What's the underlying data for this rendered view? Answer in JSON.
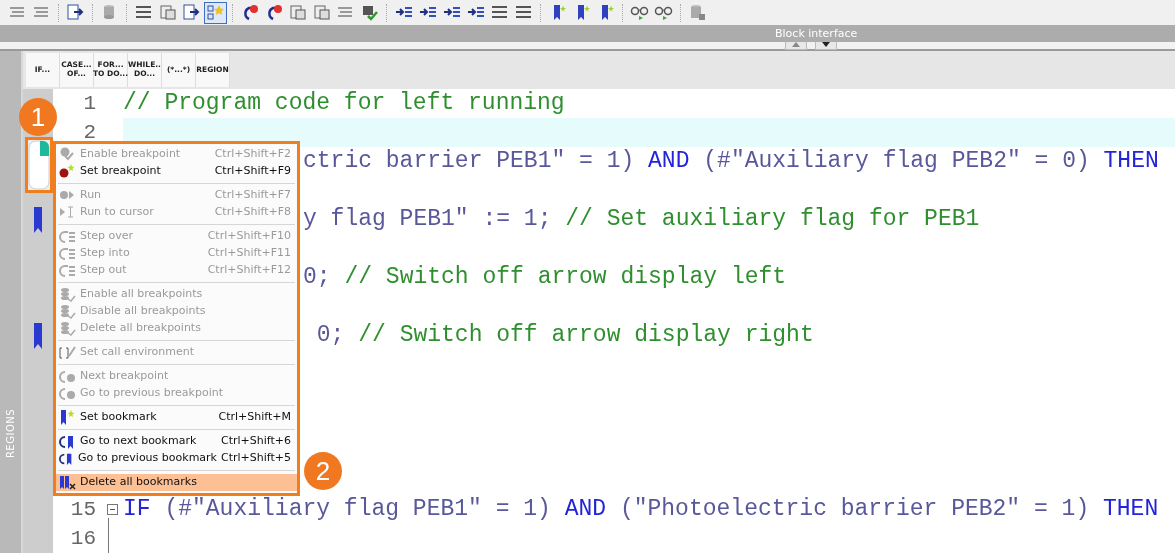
{
  "toolbar": {
    "buttons": [
      {
        "selected": false
      },
      {
        "selected": false
      },
      {
        "selected": false
      },
      {
        "selected": false
      },
      {
        "selected": false
      },
      {
        "selected": false
      },
      {
        "selected": false
      },
      {
        "selected": true
      },
      {
        "selected": false
      },
      {
        "selected": false
      },
      {
        "selected": false
      },
      {
        "selected": false
      },
      {
        "selected": false
      },
      {
        "selected": false
      },
      {
        "selected": false
      },
      {
        "selected": false
      },
      {
        "selected": false
      },
      {
        "selected": false
      },
      {
        "selected": false
      },
      {
        "selected": false
      },
      {
        "selected": false
      },
      {
        "selected": false
      },
      {
        "selected": false
      },
      {
        "selected": false
      },
      {
        "selected": false
      },
      {
        "selected": false
      }
    ]
  },
  "block_interface": {
    "title": "Block interface"
  },
  "side_panel": {
    "title": "REGIONS"
  },
  "snippets": [
    {
      "lines": [
        "IF..."
      ]
    },
    {
      "lines": [
        "CASE...",
        "OF..."
      ]
    },
    {
      "lines": [
        "FOR...",
        "TO DO..."
      ]
    },
    {
      "lines": [
        "WHILE..",
        "DO..."
      ]
    },
    {
      "lines": [
        "(*...*)"
      ]
    },
    {
      "lines": [
        "REGION"
      ]
    }
  ],
  "editor": {
    "lines": [
      {
        "kind": "full",
        "number": "1",
        "code": [
          {
            "kind": "comment",
            "text": "// Program code for left running"
          }
        ]
      },
      {
        "kind": "full",
        "number": "2",
        "current": true
      },
      {
        "kind": "tail",
        "code": [
          {
            "kind": "text",
            "text": "ctric barrier PEB1\" = 1) "
          },
          {
            "kind": "keyword",
            "text": "AND"
          },
          {
            "kind": "text",
            "text": " (#\"Auxiliary flag PEB2\" = 0) "
          },
          {
            "kind": "keyword",
            "text": "THEN"
          }
        ]
      },
      {
        "kind": "covered"
      },
      {
        "kind": "tail",
        "bookmark": true,
        "code": [
          {
            "kind": "text",
            "text": "y flag PEB1\" := 1; "
          },
          {
            "kind": "comment",
            "text": "// Set auxiliary flag for PEB1"
          }
        ]
      },
      {
        "kind": "covered"
      },
      {
        "kind": "tail",
        "code": [
          {
            "kind": "text",
            "text": "0; "
          },
          {
            "kind": "comment",
            "text": "// Switch off arrow display left"
          }
        ]
      },
      {
        "kind": "covered"
      },
      {
        "kind": "tail",
        "bookmark": true,
        "code": [
          {
            "kind": "text",
            "text": " 0; "
          },
          {
            "kind": "comment",
            "text": "// Switch off arrow display right"
          }
        ]
      },
      {
        "kind": "covered"
      },
      {
        "kind": "covered"
      },
      {
        "kind": "covered"
      },
      {
        "kind": "covered"
      },
      {
        "kind": "covered"
      },
      {
        "kind": "full",
        "number": "15",
        "fold": true,
        "code": [
          {
            "kind": "keyword",
            "text": "IF"
          },
          {
            "kind": "text",
            "text": " (#\"Auxiliary flag PEB1\" = 1) "
          },
          {
            "kind": "keyword",
            "text": "AND"
          },
          {
            "kind": "text",
            "text": " (\"Photoelectric barrier PEB2\" = 1) "
          },
          {
            "kind": "keyword",
            "text": "THEN"
          }
        ]
      },
      {
        "kind": "full",
        "number": "16"
      }
    ]
  },
  "context_menu": {
    "groups": [
      [
        {
          "label": "Enable breakpoint",
          "shortcut": "Ctrl+Shift+F2",
          "disabled": true,
          "selected": false
        },
        {
          "label": "Set breakpoint",
          "shortcut": "Ctrl+Shift+F9",
          "disabled": false,
          "selected": false
        }
      ],
      [
        {
          "label": "Run",
          "shortcut": "Ctrl+Shift+F7",
          "disabled": true,
          "selected": false
        },
        {
          "label": "Run to cursor",
          "shortcut": "Ctrl+Shift+F8",
          "disabled": true,
          "selected": false
        }
      ],
      [
        {
          "label": "Step over",
          "shortcut": "Ctrl+Shift+F10",
          "disabled": true,
          "selected": false
        },
        {
          "label": "Step into",
          "shortcut": "Ctrl+Shift+F11",
          "disabled": true,
          "selected": false
        },
        {
          "label": "Step out",
          "shortcut": "Ctrl+Shift+F12",
          "disabled": true,
          "selected": false
        }
      ],
      [
        {
          "label": "Enable all breakpoints",
          "disabled": true,
          "selected": false
        },
        {
          "label": "Disable all breakpoints",
          "disabled": true,
          "selected": false
        },
        {
          "label": "Delete all breakpoints",
          "disabled": true,
          "selected": false
        }
      ],
      [
        {
          "label": "Set call environment",
          "disabled": true,
          "selected": false
        }
      ],
      [
        {
          "label": "Next breakpoint",
          "disabled": true,
          "selected": false
        },
        {
          "label": "Go to previous breakpoint",
          "disabled": true,
          "selected": false
        }
      ],
      [
        {
          "label": "Set bookmark",
          "shortcut": "Ctrl+Shift+M",
          "disabled": false,
          "selected": false
        }
      ],
      [
        {
          "label": "Go to next bookmark",
          "shortcut": "Ctrl+Shift+6",
          "disabled": false,
          "selected": false
        },
        {
          "label": "Go to previous bookmark",
          "shortcut": "Ctrl+Shift+5",
          "disabled": false,
          "selected": false
        }
      ],
      [
        {
          "label": "Delete all bookmarks",
          "disabled": false,
          "selected": true
        }
      ]
    ]
  },
  "callouts": [
    {
      "number": "1"
    },
    {
      "number": "2"
    }
  ]
}
